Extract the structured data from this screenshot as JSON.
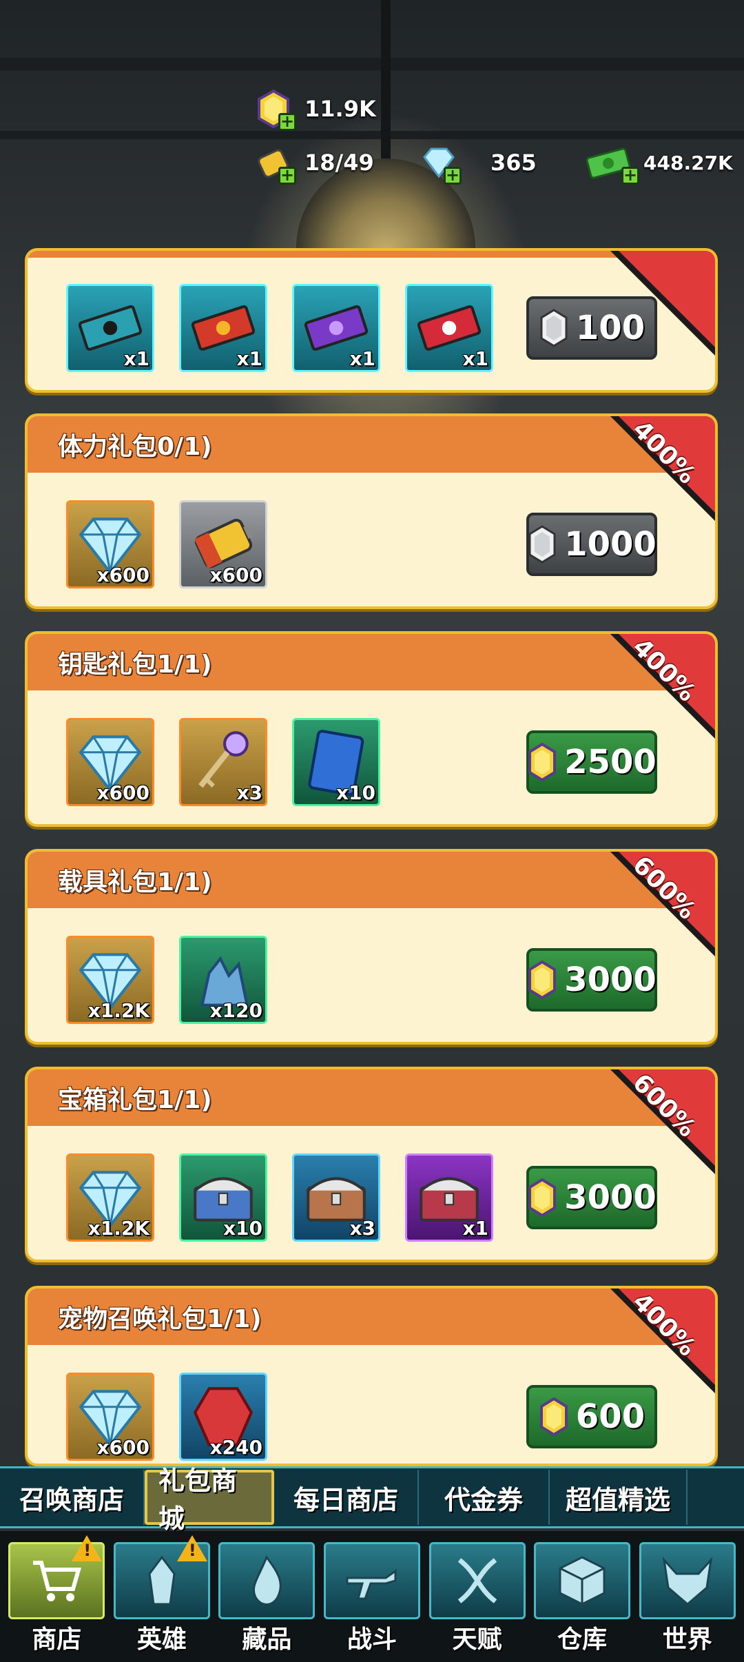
{
  "resources": {
    "gems_top": "11.9K",
    "energy": "18/49",
    "diamonds": "365",
    "cash": "448.27K"
  },
  "cards": [
    {
      "title": "",
      "badge": "",
      "items": [
        {
          "icon": "teal-ticket-icon",
          "qty": "x1",
          "frame": "teal"
        },
        {
          "icon": "red-ticket-icon",
          "qty": "x1",
          "frame": "teal"
        },
        {
          "icon": "purple-ticket-icon",
          "qty": "x1",
          "frame": "teal"
        },
        {
          "icon": "skull-ticket-icon",
          "qty": "x1",
          "frame": "teal"
        }
      ],
      "price": "100",
      "price_style": "grey"
    },
    {
      "title": "体力礼包0/1)",
      "badge": "400%",
      "items": [
        {
          "icon": "diamond-icon",
          "qty": "x600",
          "frame": "orange"
        },
        {
          "icon": "battery-icon",
          "qty": "x600",
          "frame": "grey"
        }
      ],
      "price": "1000",
      "price_style": "grey"
    },
    {
      "title": "钥匙礼包1/1)",
      "badge": "400%",
      "items": [
        {
          "icon": "diamond-icon",
          "qty": "x600",
          "frame": "orange"
        },
        {
          "icon": "key-icon",
          "qty": "x3",
          "frame": "orange"
        },
        {
          "icon": "blueprint-card-icon",
          "qty": "x10",
          "frame": "green"
        }
      ],
      "price": "2500",
      "price_style": "green"
    },
    {
      "title": "载具礼包1/1)",
      "badge": "600%",
      "items": [
        {
          "icon": "diamond-icon",
          "qty": "x1.2K",
          "frame": "orange"
        },
        {
          "icon": "crystal-ore-icon",
          "qty": "x120",
          "frame": "green"
        }
      ],
      "price": "3000",
      "price_style": "green"
    },
    {
      "title": "宝箱礼包1/1)",
      "badge": "600%",
      "items": [
        {
          "icon": "diamond-icon",
          "qty": "x1.2K",
          "frame": "orange"
        },
        {
          "icon": "blue-chest-icon",
          "qty": "x10",
          "frame": "green"
        },
        {
          "icon": "bronze-chest-icon",
          "qty": "x3",
          "frame": "blue"
        },
        {
          "icon": "red-chest-icon",
          "qty": "x1",
          "frame": "purple"
        }
      ],
      "price": "3000",
      "price_style": "green"
    },
    {
      "title": "宠物召唤礼包1/1)",
      "badge": "400%",
      "items": [
        {
          "icon": "diamond-icon",
          "qty": "x600",
          "frame": "orange"
        },
        {
          "icon": "red-gem-icon",
          "qty": "x240",
          "frame": "blue"
        }
      ],
      "price": "600",
      "price_style": "green"
    }
  ],
  "tabs": [
    "召唤商店",
    "礼包商城",
    "每日商店",
    "代金券",
    "超值精选"
  ],
  "active_tab": "礼包商城",
  "nav": [
    {
      "label": "商店",
      "icon": "cart-icon",
      "warning": true
    },
    {
      "label": "英雄",
      "icon": "hero-icon",
      "warning": true
    },
    {
      "label": "藏品",
      "icon": "flame-icon",
      "warning": false
    },
    {
      "label": "战斗",
      "icon": "rifle-icon",
      "warning": false
    },
    {
      "label": "天赋",
      "icon": "dna-icon",
      "warning": false
    },
    {
      "label": "仓库",
      "icon": "box-icon",
      "warning": false
    },
    {
      "label": "世界",
      "icon": "demon-icon",
      "warning": false
    }
  ],
  "warning_mark": "!",
  "colors": {
    "card_bg": "#fdf3d1",
    "card_head": "#e8833a",
    "card_border": "#f0bd2e",
    "ribbon": "#e03a3a",
    "price_green": "#3a9a46",
    "price_grey": "#6a6e70"
  }
}
